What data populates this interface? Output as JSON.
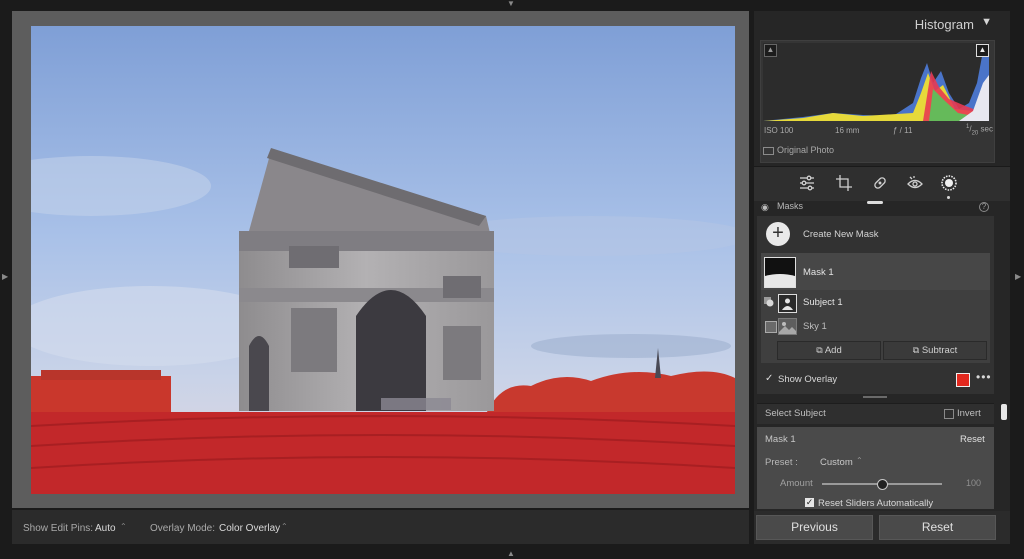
{
  "toolbar": {
    "edit_pins_label": "Show Edit Pins:",
    "edit_pins_value": "Auto",
    "overlay_mode_label": "Overlay Mode:",
    "overlay_mode_value": "Color Overlay"
  },
  "histogram": {
    "title": "Histogram",
    "iso": "ISO 100",
    "focal": "16 mm",
    "aperture": "ƒ / 11",
    "shutter_num": "1",
    "shutter_den": "20",
    "shutter_unit": "sec",
    "original_photo": "Original Photo"
  },
  "masks": {
    "header": "Masks",
    "create_label": "Create New Mask",
    "mask1_label": "Mask 1",
    "subject_label": "Subject 1",
    "sky_label": "Sky 1",
    "add_label": "Add",
    "subtract_label": "Subtract",
    "show_overlay_label": "Show Overlay",
    "overlay_color": "#e2291f"
  },
  "select_subject": {
    "label": "Select Subject",
    "invert_label": "Invert"
  },
  "adjust": {
    "mask_label": "Mask 1",
    "reset_label": "Reset",
    "preset_label": "Preset :",
    "preset_value": "Custom",
    "amount_label": "Amount",
    "amount_value": "100",
    "reset_sliders_label": "Reset Sliders Automatically"
  },
  "buttons": {
    "previous": "Previous",
    "reset": "Reset"
  }
}
